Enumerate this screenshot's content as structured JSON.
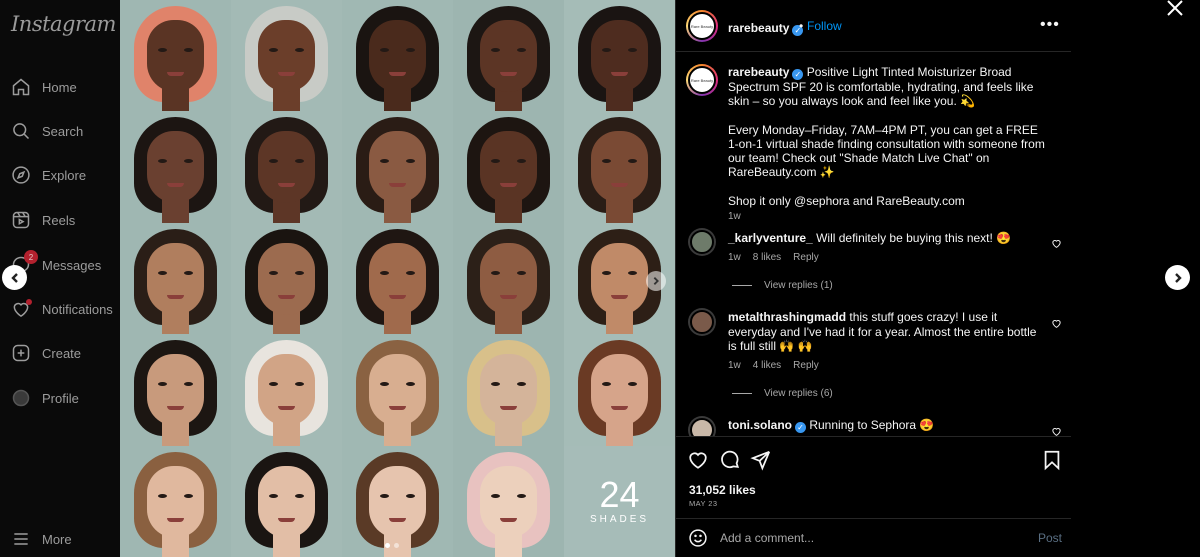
{
  "sidebar": {
    "logo": "Instagram",
    "items": [
      {
        "label": "Home",
        "icon": "home-icon"
      },
      {
        "label": "Search",
        "icon": "search-icon"
      },
      {
        "label": "Explore",
        "icon": "compass-icon"
      },
      {
        "label": "Reels",
        "icon": "reels-icon"
      },
      {
        "label": "Messages",
        "icon": "messenger-icon",
        "badge": "2"
      },
      {
        "label": "Notifications",
        "icon": "heart-icon"
      },
      {
        "label": "Create",
        "icon": "plus-square-icon"
      },
      {
        "label": "Profile",
        "icon": "avatar-icon"
      }
    ],
    "more_label": "More"
  },
  "post": {
    "shades_number": "24",
    "shades_word": "SHADES",
    "author": "rarebeauty",
    "avatar_text": "Rare Beauty",
    "separator": "•",
    "follow_label": "Follow",
    "more": "•••",
    "caption": {
      "username": "rarebeauty",
      "p1": "Positive Light Tinted Moisturizer Broad Spectrum SPF 20 is comfortable, hydrating, and feels like skin – so you always look and feel like you. 💫",
      "p2": "Every Monday–Friday, 7AM–4PM PT, you can get a FREE 1-on-1 virtual shade finding consultation with someone from our team! Check out \"Shade Match Live Chat\" on RareBeauty.com ✨",
      "p3": "Shop it only @sephora and RareBeauty.com",
      "time": "1w"
    },
    "comments": [
      {
        "username": "_karlyventure_",
        "text": "Will definitely be buying this next! 😍",
        "time": "1w",
        "likes": "8 likes",
        "reply": "Reply",
        "view_replies": "View replies (1)"
      },
      {
        "username": "metalthrashingmadd",
        "text": "this stuff goes crazy! I use it everyday and I've had it for a year. Almost the entire bottle is full still 🙌 🙌",
        "time": "1w",
        "likes": "4 likes",
        "reply": "Reply",
        "view_replies": "View replies (6)"
      },
      {
        "username": "toni.solano",
        "text": "Running to Sephora 😍"
      }
    ],
    "likes": "31,052 likes",
    "date": "MAY 23",
    "comment_placeholder": "Add a comment...",
    "post_label": "Post"
  },
  "colors": {
    "accent": "#0095f6",
    "verified": "#3897f0",
    "background": "#000000"
  }
}
